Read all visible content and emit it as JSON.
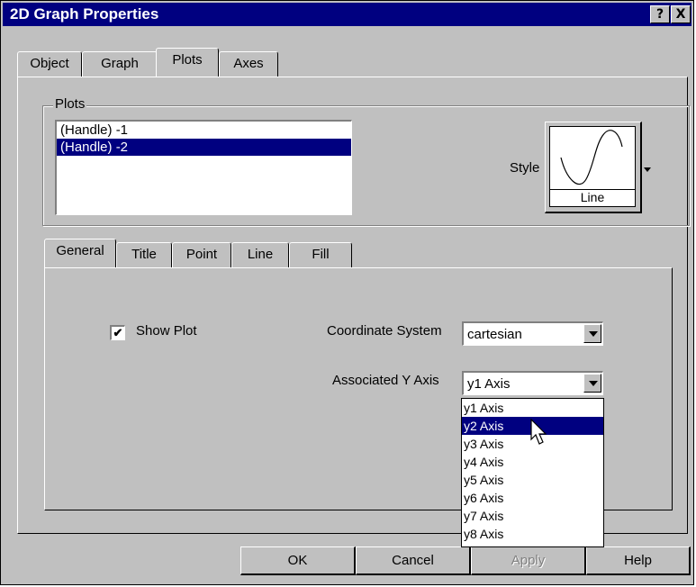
{
  "window": {
    "title": "2D Graph Properties",
    "help_btn": "?",
    "close_btn": "X"
  },
  "tabs": [
    "Object",
    "Graph",
    "Plots",
    "Axes"
  ],
  "selected_tab": "Plots",
  "plots_group": {
    "legend": "Plots",
    "items": [
      "(Handle) -1",
      "(Handle) -2"
    ],
    "selected_index": 1,
    "style_label": "Style",
    "style_value": "Line"
  },
  "subtabs": [
    "General",
    "Title",
    "Point",
    "Line",
    "Fill"
  ],
  "selected_subtab": "General",
  "general": {
    "show_plot_label": "Show Plot",
    "show_plot_checked": true,
    "checkmark": "✔",
    "coord_label": "Coordinate System",
    "coord_value": "cartesian",
    "yaxis_label": "Associated Y Axis",
    "yaxis_value": "y1 Axis",
    "yaxis_options": [
      "y1 Axis",
      "y2 Axis",
      "y3 Axis",
      "y4 Axis",
      "y5 Axis",
      "y6 Axis",
      "y7 Axis",
      "y8 Axis"
    ],
    "yaxis_highlighted": 1
  },
  "buttons": {
    "ok": "OK",
    "cancel": "Cancel",
    "apply": "Apply",
    "help": "Help"
  }
}
